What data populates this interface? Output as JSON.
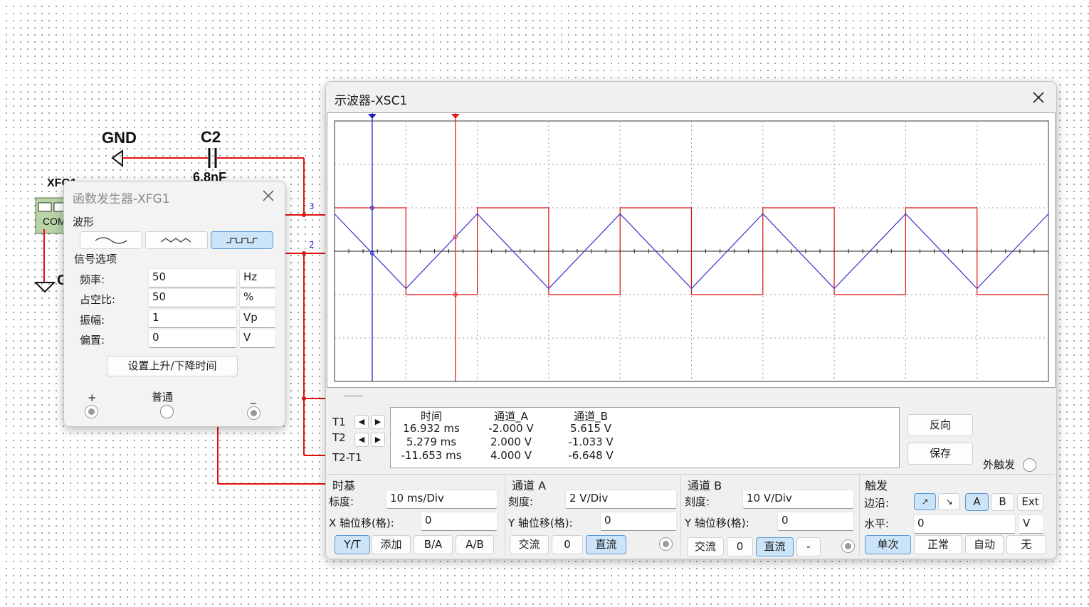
{
  "schematic": {
    "gnd_label": "GND",
    "c2_label": "C2",
    "c2_value": "6.8nF",
    "xfg_label": "XFG1",
    "com_label": "COM",
    "ground2_label": "G",
    "node_3": "3",
    "node_2": "2"
  },
  "funcgen": {
    "title": "函数发生器-XFG1",
    "waveform_label": "波形",
    "waveforms": [
      "sine",
      "triangle",
      "square"
    ],
    "selected_waveform": "square",
    "signal_options_label": "信号选项",
    "rows": [
      {
        "label": "频率:",
        "value": "50",
        "unit": "Hz"
      },
      {
        "label": "占空比:",
        "value": "50",
        "unit": "%"
      },
      {
        "label": "振幅:",
        "value": "1",
        "unit": "Vp"
      },
      {
        "label": "偏置:",
        "value": "0",
        "unit": "V"
      }
    ],
    "rise_fall_button": "设置上升/下降时间",
    "plus": "+",
    "common": "普通",
    "minus": "_"
  },
  "scope": {
    "title": "示波器-XSC1",
    "screen_bg": "#ffffff",
    "channel_a_color": "#e01010",
    "channel_b_color": "#3030d0",
    "cursor_t1_color": "#2020c0",
    "cursor_t2_color": "#e02020",
    "readout": {
      "t1_label": "T1",
      "t2_label": "T2",
      "t2t1_label": "T2-T1",
      "col_time": "时间",
      "col_a": "通道_A",
      "col_b": "通道_B",
      "rows": [
        {
          "time": "16.932 ms",
          "a": "-2.000 V",
          "b": "5.615 V"
        },
        {
          "time": "5.279 ms",
          "a": "2.000 V",
          "b": "-1.033 V"
        },
        {
          "time": "-11.653 ms",
          "a": "4.000 V",
          "b": "-6.648 V"
        }
      ]
    },
    "reverse_button": "反向",
    "save_button": "保存",
    "ext_trigger_label": "外触发",
    "timebase": {
      "title": "时基",
      "scale_label": "标度:",
      "scale_value": "10 ms/Div",
      "xpos_label": "X 轴位移(格):",
      "xpos_value": "0",
      "buttons": [
        "Y/T",
        "添加",
        "B/A",
        "A/B"
      ],
      "active": "Y/T"
    },
    "channel_a": {
      "title": "通道 A",
      "scale_label": "刻度:",
      "scale_value": "2  V/Div",
      "ypos_label": "Y 轴位移(格):",
      "ypos_value": "0",
      "coupling": [
        "交流",
        "0",
        "直流"
      ],
      "active": "直流"
    },
    "channel_b": {
      "title": "通道 B",
      "scale_label": "刻度:",
      "scale_value": "10  V/Div",
      "ypos_label": "Y 轴位移(格):",
      "ypos_value": "0",
      "coupling": [
        "交流",
        "0",
        "直流",
        "-"
      ],
      "active": "直流"
    },
    "trigger": {
      "title": "触发",
      "edge_label": "边沿:",
      "edge_buttons": [
        "↗",
        "↘",
        "A",
        "B",
        "Ext"
      ],
      "active_edge": "↗",
      "active_source": "A",
      "level_label": "水平:",
      "level_value": "0",
      "level_unit": "V",
      "modes": [
        "单次",
        "正常",
        "自动",
        "无"
      ],
      "active_mode": "单次"
    }
  },
  "chart_data": {
    "type": "line",
    "xlabel": "",
    "ylabel": "",
    "time_per_div_ms": 10,
    "divisions_x": 10,
    "divisions_y": 6,
    "series": [
      {
        "channel": "A",
        "volts_per_div": 2,
        "waveform": "square",
        "frequency_hz": 50,
        "duty_percent": 50,
        "x_ms": [
          0,
          10,
          10,
          20,
          20,
          30,
          30,
          40,
          40,
          50,
          50,
          60,
          60,
          70,
          70,
          80,
          80,
          90,
          90,
          100
        ],
        "y_v": [
          2,
          2,
          -2,
          -2,
          2,
          2,
          -2,
          -2,
          2,
          2,
          -2,
          -2,
          2,
          2,
          -2,
          -2,
          2,
          2,
          -2,
          -2
        ]
      },
      {
        "channel": "B",
        "volts_per_div": 10,
        "waveform": "triangle",
        "frequency_hz": 50,
        "x_ms": [
          0,
          10,
          20,
          30,
          40,
          50,
          60,
          70,
          80,
          90,
          100
        ],
        "y_v": [
          8.6,
          -8.6,
          8.6,
          -8.6,
          8.6,
          -8.6,
          8.6,
          -8.6,
          8.6,
          -8.6,
          8.6
        ]
      }
    ],
    "cursors": {
      "T1_ms": 5.279,
      "T2_ms": 16.932
    }
  }
}
